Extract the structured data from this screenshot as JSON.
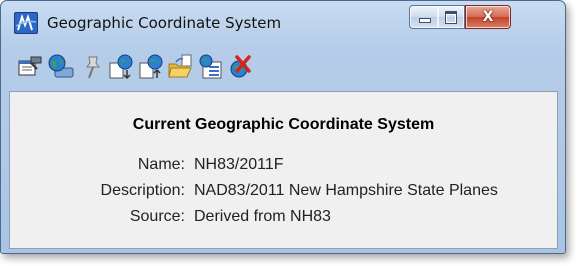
{
  "window": {
    "title": "Geographic Coordinate System",
    "app_icon": "geo-coordinate-app-icon",
    "caption_buttons": {
      "minimize_icon": "minimize-icon",
      "maximize_icon": "maximize-icon",
      "close_glyph": "X"
    }
  },
  "toolbar": {
    "tools": [
      {
        "icon": "properties-pointer-icon"
      },
      {
        "icon": "globe-from-library-icon"
      },
      {
        "icon": "pushpin-icon"
      },
      {
        "icon": "import-globe-icon"
      },
      {
        "icon": "export-globe-icon"
      },
      {
        "icon": "open-folder-icon"
      },
      {
        "icon": "globe-list-icon"
      },
      {
        "icon": "remove-globe-icon"
      }
    ]
  },
  "details": {
    "heading": "Current Geographic Coordinate System",
    "name_label": "Name:",
    "name_value": "NH83/2011F",
    "description_label": "Description:",
    "description_value": "NAD83/2011 New Hampshire State Planes",
    "source_label": "Source:",
    "source_value": "Derived from NH83"
  },
  "colors": {
    "title_bar": "#b8d0eb",
    "close_button": "#c94a33",
    "content_bg": "#f0f0f0"
  }
}
